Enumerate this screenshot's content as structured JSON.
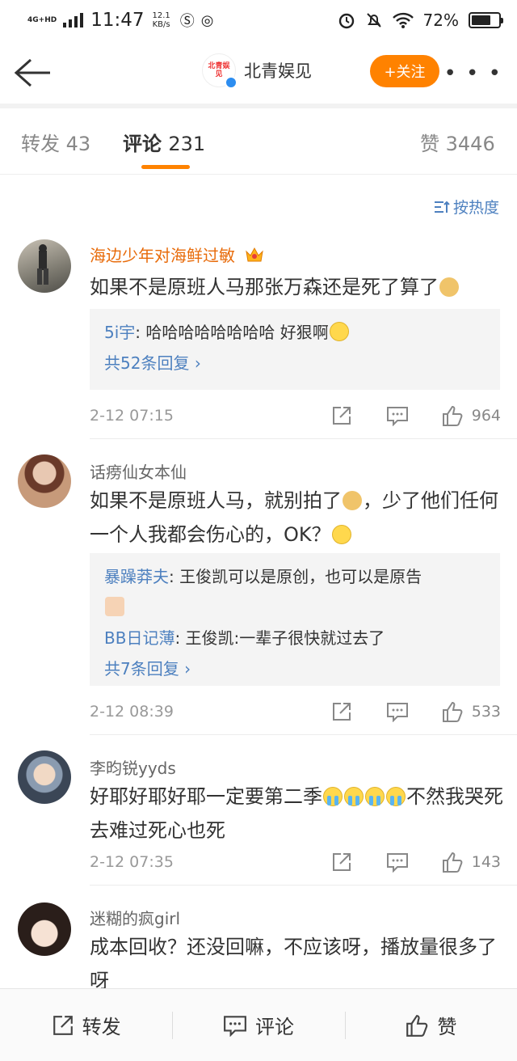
{
  "status_bar": {
    "network": "4G+HD",
    "time": "11:47",
    "speed_value": "12.1",
    "speed_unit": "KB/s",
    "battery": "72%",
    "battery_level": 0.72
  },
  "navbar": {
    "title": "北青娱见",
    "avatar_text": "北青娱见",
    "follow_label": "+关注"
  },
  "tabs": [
    {
      "label": "转发",
      "count": "43"
    },
    {
      "label": "评论",
      "count": "231"
    },
    {
      "label": "赞",
      "count": "3446"
    }
  ],
  "sort_label": "按热度",
  "comments": [
    {
      "username": "海边少年对海鲜过敏",
      "text": "如果不是原班人马那张万森还是死了算了",
      "replies": [
        {
          "user": "5i宇",
          "text": ": 哈哈哈哈哈哈哈哈 好狠啊"
        }
      ],
      "more_replies": "共52条回复",
      "time": "2-12 07:15",
      "likes": "964"
    },
    {
      "username": "话痨仙女本仙",
      "text_a": "如果不是原班人马，就别拍了",
      "text_b": "，少了他们任何一个人我都会伤心的，OK？",
      "replies": [
        {
          "user": "暴躁莽夫",
          "text": ": 王俊凯可以是原创，也可以是原告"
        },
        {
          "user": "BB日记薄",
          "text": ": 王俊凯:一辈子很快就过去了"
        }
      ],
      "more_replies": "共7条回复",
      "time": "2-12 08:39",
      "likes": "533"
    },
    {
      "username": "李昀锐yyds",
      "text_a": "好耶好耶好耶一定要第二季",
      "text_b": "不然我哭死去难过死心也死",
      "time": "2-12 07:35",
      "likes": "143"
    },
    {
      "username": "迷糊的疯girl",
      "text": "成本回收？还没回嘛，不应该呀，播放量很多了呀"
    }
  ],
  "bottom_bar": {
    "repost": "转发",
    "comment": "评论",
    "like": "赞"
  },
  "colors": {
    "accent": "#ff8200",
    "link": "#4d80bf",
    "vip_name": "#e86b0a"
  }
}
